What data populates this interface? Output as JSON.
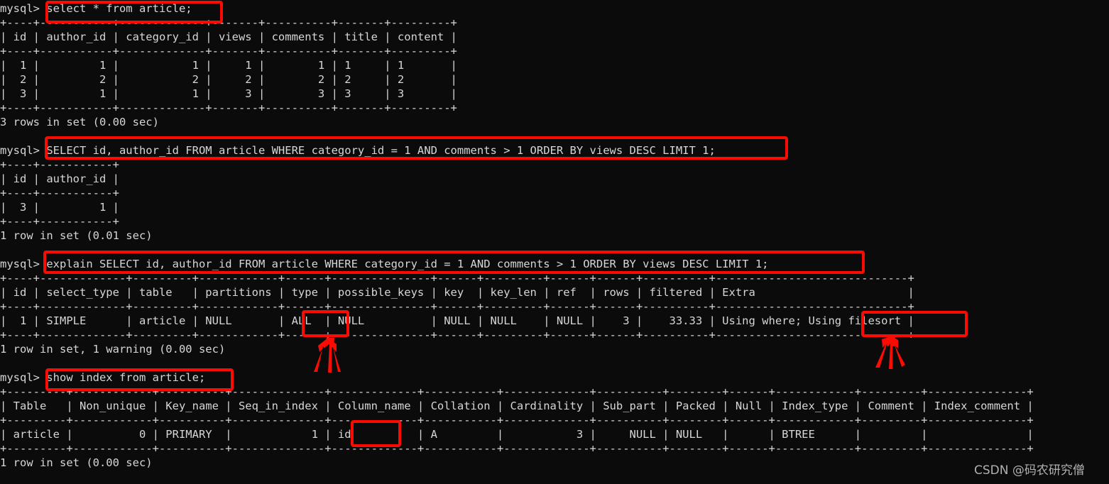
{
  "terminal": {
    "prompt": "mysql>",
    "background_color": "#0b0b0b",
    "text_color": "#d6d6d6",
    "annotation_color": "#fb0b04",
    "lines": [
      "mysql> select * from article;",
      "+----+-----------+-------------+-------+----------+-------+---------+",
      "| id | author_id | category_id | views | comments | title | content |",
      "+----+-----------+-------------+-------+----------+-------+---------+",
      "|  1 |         1 |           1 |     1 |        1 | 1     | 1       |",
      "|  2 |         2 |           2 |     2 |        2 | 2     | 2       |",
      "|  3 |         1 |           1 |     3 |        3 | 3     | 3       |",
      "+----+-----------+-------------+-------+----------+-------+---------+",
      "3 rows in set (0.00 sec)",
      "",
      "mysql> SELECT id, author_id FROM article WHERE category_id = 1 AND comments > 1 ORDER BY views DESC LIMIT 1;",
      "+----+-----------+",
      "| id | author_id |",
      "+----+-----------+",
      "|  3 |         1 |",
      "+----+-----------+",
      "1 row in set (0.01 sec)",
      "",
      "mysql> explain SELECT id, author_id FROM article WHERE category_id = 1 AND comments > 1 ORDER BY views DESC LIMIT 1;",
      "+----+-------------+---------+------------+------+---------------+------+---------+------+------+----------+-----------------------------+",
      "| id | select_type | table   | partitions | type | possible_keys | key  | key_len | ref  | rows | filtered | Extra                       |",
      "+----+-------------+---------+------------+------+---------------+------+---------+------+------+----------+-----------------------------+",
      "|  1 | SIMPLE      | article | NULL       | ALL  | NULL          | NULL | NULL    | NULL |    3 |    33.33 | Using where; Using filesort |",
      "+----+-------------+---------+------------+------+---------------+------+---------+------+------+----------+-----------------------------+",
      "1 row in set, 1 warning (0.00 sec)",
      "",
      "mysql> show index from article;",
      "+---------+------------+----------+--------------+-------------+-----------+-------------+----------+--------+------+------------+---------+---------------+",
      "| Table   | Non_unique | Key_name | Seq_in_index | Column_name | Collation | Cardinality | Sub_part | Packed | Null | Index_type | Comment | Index_comment |",
      "+---------+------------+----------+--------------+-------------+-----------+-------------+----------+--------+------+------------+---------+---------------+",
      "| article |          0 | PRIMARY  |            1 | id          | A         |           3 |     NULL | NULL   |      | BTREE      |         |               |",
      "+---------+------------+----------+--------------+-------------+-----------+-------------+----------+--------+------+------------+---------+---------------+",
      "1 row in set (0.00 sec)",
      ""
    ]
  },
  "queries": [
    {
      "id": "q1",
      "sql": "select * from article;",
      "status": "3 rows in set (0.00 sec)",
      "result": {
        "columns": [
          "id",
          "author_id",
          "category_id",
          "views",
          "comments",
          "title",
          "content"
        ],
        "rows": [
          [
            "1",
            "1",
            "1",
            "1",
            "1",
            "1",
            "1"
          ],
          [
            "2",
            "2",
            "2",
            "2",
            "2",
            "2",
            "2"
          ],
          [
            "3",
            "1",
            "1",
            "3",
            "3",
            "3",
            "3"
          ]
        ]
      }
    },
    {
      "id": "q2",
      "sql": "SELECT id, author_id FROM article WHERE category_id = 1 AND comments > 1 ORDER BY views DESC LIMIT 1;",
      "status": "1 row in set (0.01 sec)",
      "result": {
        "columns": [
          "id",
          "author_id"
        ],
        "rows": [
          [
            "3",
            "1"
          ]
        ]
      }
    },
    {
      "id": "q3",
      "sql": "explain SELECT id, author_id FROM article WHERE category_id = 1 AND comments > 1 ORDER BY views DESC LIMIT 1;",
      "status": "1 row in set, 1 warning (0.00 sec)",
      "result": {
        "columns": [
          "id",
          "select_type",
          "table",
          "partitions",
          "type",
          "possible_keys",
          "key",
          "key_len",
          "ref",
          "rows",
          "filtered",
          "Extra"
        ],
        "rows": [
          [
            "1",
            "SIMPLE",
            "article",
            "NULL",
            "ALL",
            "NULL",
            "NULL",
            "NULL",
            "NULL",
            "3",
            "33.33",
            "Using where; Using filesort"
          ]
        ]
      }
    },
    {
      "id": "q4",
      "sql": "show index from article;",
      "status": "1 row in set (0.00 sec)",
      "result": {
        "columns": [
          "Table",
          "Non_unique",
          "Key_name",
          "Seq_in_index",
          "Column_name",
          "Collation",
          "Cardinality",
          "Sub_part",
          "Packed",
          "Null",
          "Index_type",
          "Comment",
          "Index_comment"
        ],
        "rows": [
          [
            "article",
            "0",
            "PRIMARY",
            "1",
            "id",
            "A",
            "3",
            "NULL",
            "NULL",
            "",
            "BTREE",
            "",
            ""
          ]
        ]
      }
    }
  ],
  "annotations": {
    "highlight_boxes": [
      {
        "name": "select-star-query",
        "label": "select * from article;"
      },
      {
        "name": "select-filtered-query",
        "label": "SELECT id, author_id FROM article WHERE category_id = 1 AND comments > 1 ORDER BY views DESC LIMIT 1;"
      },
      {
        "name": "explain-query",
        "label": "explain SELECT id, author_id FROM article WHERE category_id = 1 AND comments > 1 ORDER BY views DESC LIMIT 1;"
      },
      {
        "name": "type-all-cell",
        "label": "ALL"
      },
      {
        "name": "extra-using-filesort-cell",
        "label": "Using filesort"
      },
      {
        "name": "show-index-query",
        "label": "show index from article;"
      },
      {
        "name": "column-name-id-cell",
        "label": "id"
      }
    ],
    "arrow_groups": [
      {
        "name": "arrows-pointing-to-type-all",
        "count": 3,
        "target": "ALL"
      },
      {
        "name": "arrows-pointing-to-using-filesort",
        "count": 2,
        "target": "Using filesort"
      }
    ]
  },
  "watermark": {
    "text": "CSDN @码农研究僧"
  }
}
